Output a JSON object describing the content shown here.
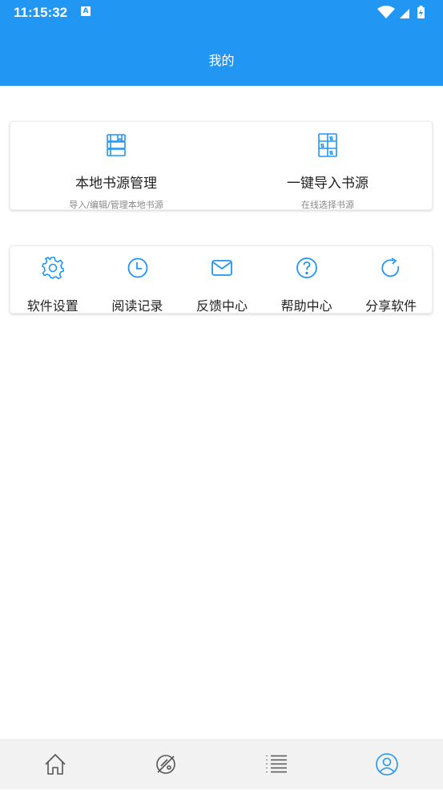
{
  "status_bar": {
    "time": "11:15:32",
    "badge": "A"
  },
  "header": {
    "title": "我的"
  },
  "book_sources": [
    {
      "title": "本地书源管理",
      "subtitle": "导入/编辑/管理本地书源",
      "icon": "books-icon"
    },
    {
      "title": "一键导入书源",
      "subtitle": "在线选择书源",
      "icon": "bookshelf-icon"
    }
  ],
  "menu": [
    {
      "label": "软件设置",
      "icon": "gear-icon"
    },
    {
      "label": "阅读记录",
      "icon": "clock-icon"
    },
    {
      "label": "反馈中心",
      "icon": "mail-icon"
    },
    {
      "label": "帮助中心",
      "icon": "help-icon"
    },
    {
      "label": "分享软件",
      "icon": "share-icon"
    }
  ],
  "bottom_nav": [
    {
      "icon": "home-icon"
    },
    {
      "icon": "explore-icon"
    },
    {
      "icon": "list-icon"
    },
    {
      "icon": "profile-icon",
      "active": true
    }
  ],
  "colors": {
    "primary": "#2196F3",
    "nav_inactive": "#555555",
    "background": "#ffffff"
  }
}
